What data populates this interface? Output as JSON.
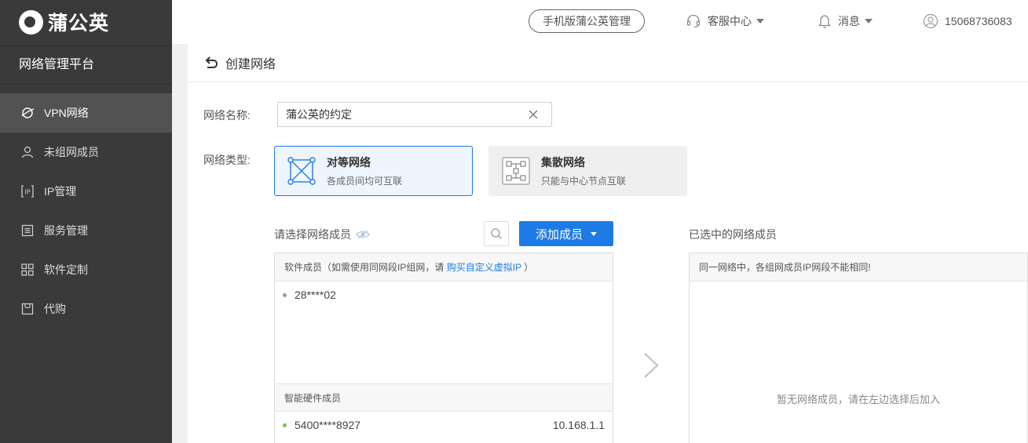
{
  "brand": {
    "name": "蒲公英",
    "platform": "网络管理平台"
  },
  "sidebar": {
    "items": [
      {
        "label": "VPN网络",
        "icon": "vpn-network-icon",
        "active": true
      },
      {
        "label": "未组网成员",
        "icon": "user-icon",
        "active": false
      },
      {
        "label": "IP管理",
        "icon": "ip-icon",
        "active": false
      },
      {
        "label": "服务管理",
        "icon": "service-list-icon",
        "active": false
      },
      {
        "label": "软件定制",
        "icon": "grid-apps-icon",
        "active": false
      },
      {
        "label": "代购",
        "icon": "box-icon",
        "active": false
      }
    ]
  },
  "header": {
    "mobile_manage": "手机版蒲公英管理",
    "support": "客服中心",
    "messages": "消息",
    "account": "15068736083"
  },
  "page": {
    "title": "创建网络"
  },
  "form": {
    "name_label": "网络名称:",
    "name_value": "蒲公英的约定",
    "type_label": "网络类型:",
    "types": [
      {
        "title": "对等网络",
        "desc": "各成员间均可互联",
        "selected": true
      },
      {
        "title": "集散网络",
        "desc": "只能与中心节点互联",
        "selected": false
      }
    ]
  },
  "members": {
    "select_label": "请选择网络成员",
    "add_button": "添加成员",
    "software_head_prefix": "软件成员（如需使用同网段IP组网，请 ",
    "software_head_link": "购买自定义虚拟IP",
    "software_head_suffix": " ）",
    "software_list": [
      {
        "id": "28****02"
      }
    ],
    "hardware_head": "智能硬件成员",
    "hardware_list": [
      {
        "id": "5400****8927",
        "ip": "10.168.1.1",
        "online": true
      }
    ]
  },
  "selected": {
    "label": "已选中的网络成员",
    "warning": "同一网络中，各组网成员IP网段不能相同!",
    "empty": "暂无网络成员，请在左边选择后加入"
  },
  "colors": {
    "accent": "#1e7be6",
    "sidebar": "#3a3a3a",
    "sidebar_active": "#525252"
  }
}
